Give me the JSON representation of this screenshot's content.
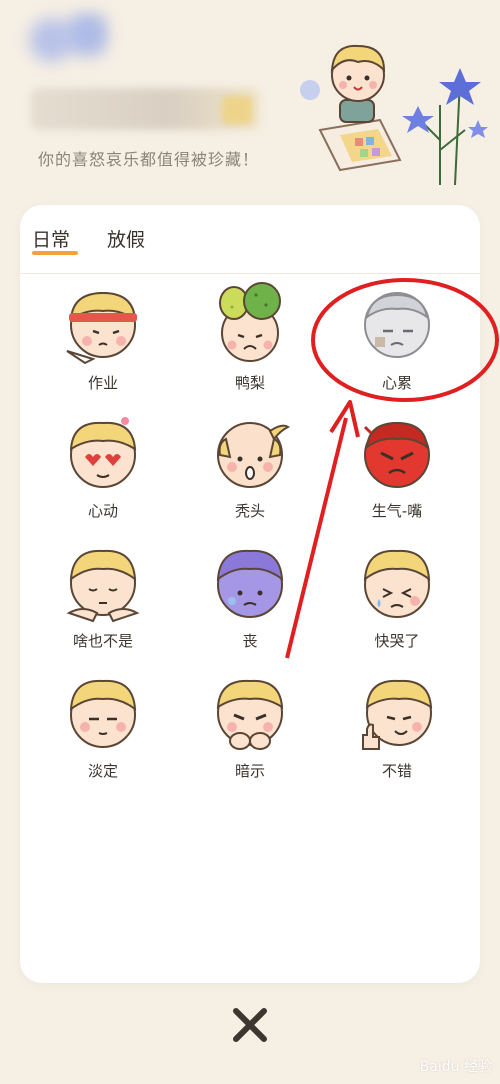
{
  "header": {
    "subtitle": "你的喜怒哀乐都值得被珍藏！"
  },
  "tabs": [
    {
      "label": "日常",
      "active": true
    },
    {
      "label": "放假",
      "active": false
    }
  ],
  "moods": [
    {
      "label": "作业",
      "icon": "homework-face-icon"
    },
    {
      "label": "鸭梨",
      "icon": "pear-face-icon"
    },
    {
      "label": "心累",
      "icon": "tired-heart-face-icon"
    },
    {
      "label": "心动",
      "icon": "heart-eyes-face-icon"
    },
    {
      "label": "秃头",
      "icon": "bald-face-icon"
    },
    {
      "label": "生气-嘴",
      "icon": "angry-face-icon"
    },
    {
      "label": "啥也不是",
      "icon": "meh-face-icon"
    },
    {
      "label": "丧",
      "icon": "gloomy-face-icon"
    },
    {
      "label": "快哭了",
      "icon": "almost-crying-face-icon"
    },
    {
      "label": "淡定",
      "icon": "calm-face-icon"
    },
    {
      "label": "暗示",
      "icon": "hint-face-icon"
    },
    {
      "label": "不错",
      "icon": "thumbs-up-face-icon"
    }
  ],
  "footer": {
    "watermark": "Baidu 经验"
  },
  "colors": {
    "accent": "#f0a437",
    "background": "#f6efe4",
    "annotation": "#e02020"
  }
}
